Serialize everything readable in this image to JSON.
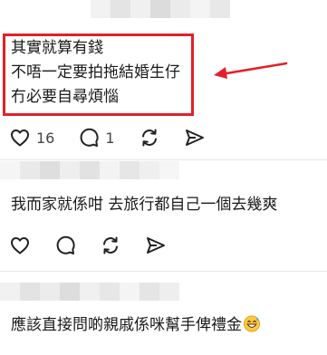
{
  "posts": [
    {
      "text_lines": [
        "其實就算有錢",
        "不唔一定要拍拖結婚生仔",
        "冇必要自尋煩惱"
      ],
      "likes": "16",
      "replies": "1",
      "highlighted": true,
      "highlight_color": "#e3202a"
    },
    {
      "text_lines": [
        "我而家就係咁 去旅行都自己一個去幾爽"
      ],
      "likes": "",
      "replies": "",
      "highlighted": false
    },
    {
      "text_lines": [
        "應該直接問啲親戚係咪幫手俾禮金"
      ],
      "trailing_emoji": "grinning-sweat-emoji",
      "highlighted": false
    }
  ],
  "icons": {
    "like": "heart-icon",
    "reply": "comment-bubble-icon",
    "repost": "repost-icon",
    "share": "send-icon"
  },
  "colors": {
    "annotation_red": "#e3202a",
    "text": "#1a1a1a",
    "icon": "#222222",
    "count": "#444444"
  }
}
